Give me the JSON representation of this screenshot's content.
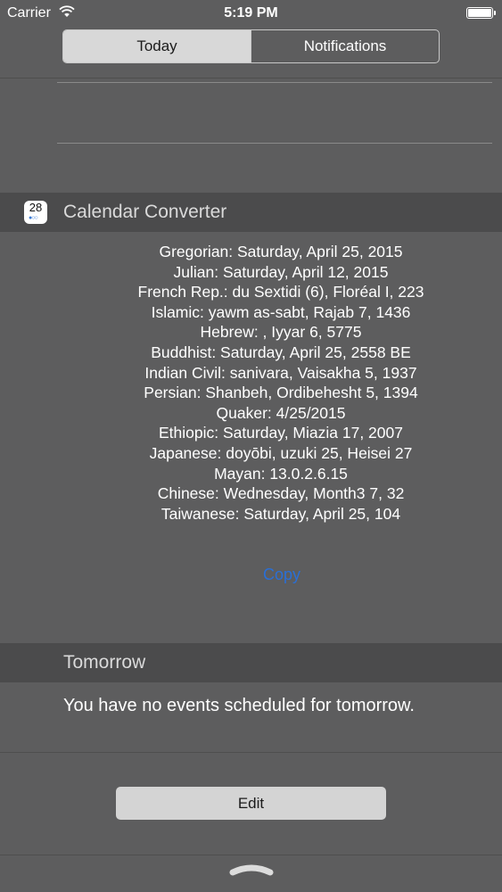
{
  "status_bar": {
    "carrier": "Carrier",
    "time": "5:19 PM"
  },
  "tabs": [
    {
      "label": "Today",
      "active": true
    },
    {
      "label": "Notifications",
      "active": false
    }
  ],
  "widget": {
    "icon_text": "28",
    "title": "Calendar Converter",
    "lines": [
      "Gregorian: Saturday, April 25, 2015",
      "Julian: Saturday, April 12, 2015",
      "French Rep.: du Sextidi (6), Floréal I, 223",
      "Islamic: yawm as-sabt, Rajab 7, 1436",
      "Hebrew: , Iyyar 6, 5775",
      "Buddhist: Saturday, April 25, 2558 BE",
      "Indian Civil: sanivara, Vaisakha 5, 1937",
      "Persian: Shanbeh, Ordibehesht 5, 1394",
      "Quaker: 4/25/2015",
      "Ethiopic: Saturday, Miazia 17, 2007",
      "Japanese: doyōbi, uzuki 25, Heisei 27",
      "Mayan: 13.0.2.6.15",
      "Chinese: Wednesday, Month3 7, 32",
      "Taiwanese: Saturday, April 25, 104"
    ],
    "copy_label": "Copy"
  },
  "tomorrow": {
    "title": "Tomorrow",
    "message": "You have no events scheduled for tomorrow."
  },
  "edit_label": "Edit",
  "colors": {
    "background": "#5d5d5e",
    "header": "#4b4b4c",
    "link": "#2a6fd6"
  }
}
